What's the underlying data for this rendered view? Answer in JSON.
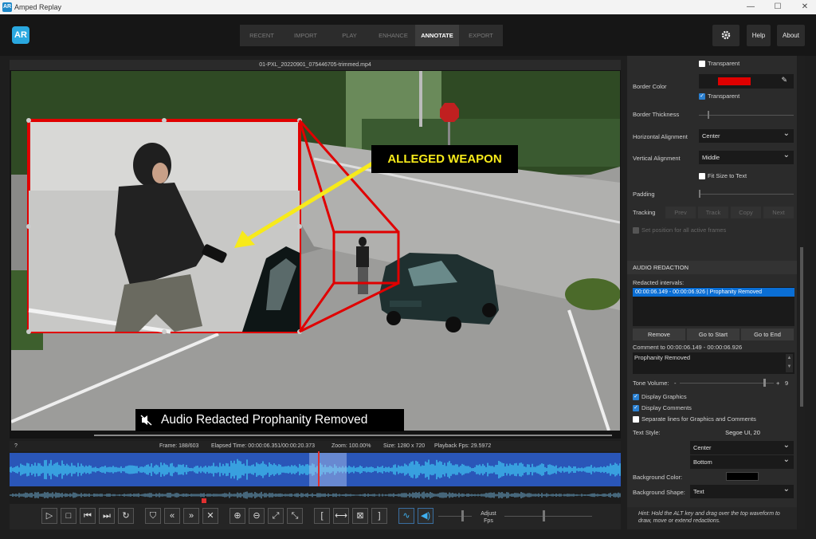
{
  "window": {
    "title": "Amped Replay",
    "icon_text": "AR"
  },
  "nav": {
    "tabs": [
      "RECENT",
      "IMPORT",
      "PLAY",
      "ENHANCE",
      "ANNOTATE",
      "EXPORT"
    ],
    "active": "ANNOTATE",
    "help": "Help",
    "about": "About"
  },
  "viewer": {
    "filename": "01-PXL_20220901_075446705-trimmed.mp4",
    "annotation_text": "ALLEGED WEAPON",
    "caption": "Audio Redacted Prophanity Removed"
  },
  "status": {
    "marker": "?",
    "frame": "Frame: 188/603",
    "elapsed": "Elapsed Time: 00:00:06.351/00:00:20.373",
    "zoom": "Zoom: 100.00%",
    "size": "Size: 1280 x 720",
    "fps": "Playback Fps: 29.5972"
  },
  "playback": {
    "adjust_label": "Adjust\nFps"
  },
  "panel": {
    "transparent1": "Transparent",
    "border_color_label": "Border Color",
    "border_color": "#e00000",
    "transparent2": "Transparent",
    "border_thickness_label": "Border Thickness",
    "h_align_label": "Horizontal Alignment",
    "h_align": "Center",
    "v_align_label": "Vertical Alignment",
    "v_align": "Middle",
    "fit_label": "Fit Size to Text",
    "padding_label": "Padding",
    "tracking_label": "Tracking",
    "tracking_buttons": [
      "Prev",
      "Track",
      "Copy",
      "Next"
    ],
    "set_position_label": "Set position for all active frames",
    "audio_header": "AUDIO REDACTION",
    "redacted_label": "Redacted intervals:",
    "interval": "00:00:06.149 - 00:00:06.926  |  Prophanity Removed",
    "remove": "Remove",
    "goto_start": "Go to Start",
    "goto_end": "Go to End",
    "comment_label": "Comment to 00:00:06.149 - 00:00:06.926",
    "comment": "Prophanity Removed",
    "tone_label": "Tone Volume:",
    "tone_minus": "-",
    "tone_plus": "+",
    "tone_value": "9",
    "display_graphics": "Display Graphics",
    "display_comments": "Display Comments",
    "separate_lines": "Separate lines for Graphics and Comments",
    "text_style_label": "Text Style:",
    "text_style": "Segoe UI, 20",
    "text_h": "Center",
    "text_v": "Bottom",
    "bg_color_label": "Background Color:",
    "bg_color": "#000000",
    "bg_shape_label": "Background Shape:",
    "bg_shape": "Text",
    "hint": "Hint: Hold the ALT key and drag over the top waveform to draw, move or extend redactions."
  }
}
